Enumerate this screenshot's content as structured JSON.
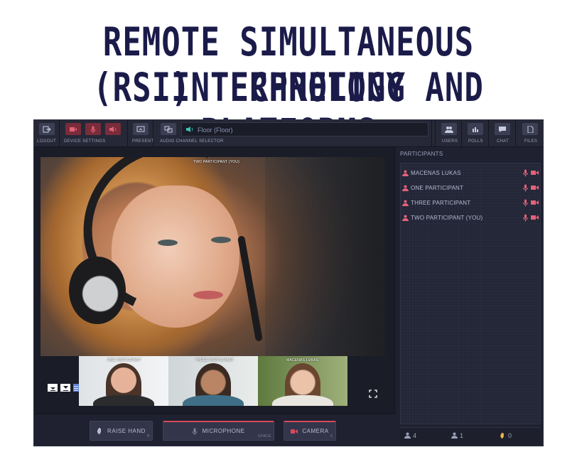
{
  "headline": {
    "line1": "REMOTE SIMULTANEOUS INTERPRETING",
    "line2": "(RSI) TECHNOLOGY AND PLATFORMS"
  },
  "toolbar": {
    "logout_label": "LOGOUT",
    "device_settings_label": "DEVICE SETTINGS",
    "present_label": "PRESENT",
    "audio_channel_label": "AUDIO CHANNEL SELECTOR",
    "audio_channel_value": "Floor (Floor)",
    "users_label": "USERS",
    "polls_label": "POLLS",
    "chat_label": "CHAT",
    "files_label": "FILES"
  },
  "video": {
    "main_label": "TWO PARTICIPANT (YOU)",
    "thumbnails": [
      {
        "label": "ONE PARTICIPANT"
      },
      {
        "label": "THREE PARTICIPANT"
      },
      {
        "label": "MACENAS LUKAS"
      }
    ]
  },
  "participants": {
    "title": "PARTICIPANTS",
    "list": [
      {
        "name": "MACENAS LUKAS"
      },
      {
        "name": "ONE PARTICIPANT"
      },
      {
        "name": "THREE PARTICIPANT"
      },
      {
        "name": "TWO PARTICIPANT (YOU)"
      }
    ],
    "counts": {
      "users": "4",
      "speakers": "1",
      "hands": "0"
    }
  },
  "bottom": {
    "raise_hand": {
      "label": "RAISE HAND",
      "hint": "H"
    },
    "microphone": {
      "label": "MICROPHONE",
      "hint": "SPACE"
    },
    "camera": {
      "label": "CAMERA",
      "hint": "C"
    }
  },
  "colors": {
    "accent_red": "#d64a5a",
    "panel_bg": "#1f2130",
    "headline": "#1b1b4a"
  }
}
